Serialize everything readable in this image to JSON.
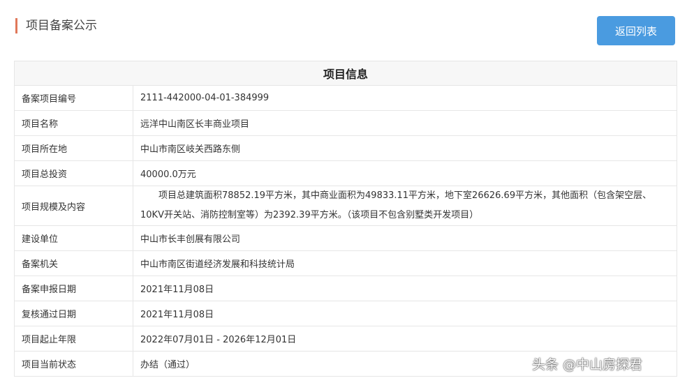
{
  "page_title": "项目备案公示",
  "back_button": "返回列表",
  "table_title": "项目信息",
  "rows": [
    {
      "label": "备案项目编号",
      "value": "2111-442000-04-01-384999"
    },
    {
      "label": "项目名称",
      "value": "远洋中山南区长丰商业项目"
    },
    {
      "label": "项目所在地",
      "value": "中山市南区岐关西路东侧"
    },
    {
      "label": "项目总投资",
      "value": "40000.0万元"
    },
    {
      "label": "项目规模及内容",
      "value": "　　项目总建筑面积78852.19平方米，其中商业面积为49833.11平方米，地下室26626.69平方米，其他面积（包含架空层、10KV开关站、消防控制室等）为2392.39平方米。（该项目不包含别墅类开发项目）"
    },
    {
      "label": "建设单位",
      "value": "中山市长丰创展有限公司"
    },
    {
      "label": "备案机关",
      "value": "中山市南区街道经济发展和科技统计局"
    },
    {
      "label": "备案申报日期",
      "value": "2021年11月08日"
    },
    {
      "label": "复核通过日期",
      "value": "2021年11月08日"
    },
    {
      "label": "项目起止年限",
      "value": "2022年07月01日 - 2026年12月01日"
    },
    {
      "label": "项目当前状态",
      "value": "办结（通过）"
    }
  ],
  "watermark": "头条 @中山房探君"
}
